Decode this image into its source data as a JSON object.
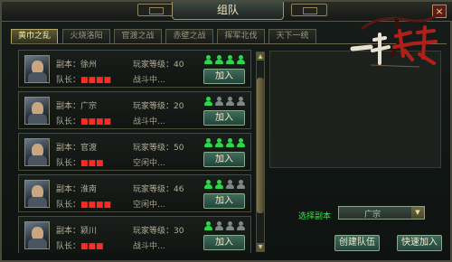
{
  "window": {
    "title": "组队",
    "close_glyph": "×"
  },
  "tabs": [
    "黄巾之乱",
    "火烧洛阳",
    "官渡之战",
    "赤壁之战",
    "挥军北伐",
    "天下一统"
  ],
  "active_tab_index": 0,
  "labels": {
    "dungeon_prefix": "副本：",
    "leader_prefix": "队长：",
    "level_prefix": "玩家等级："
  },
  "teams": [
    {
      "dungeon": "徐州",
      "leader": "■■■■",
      "level": "40",
      "status": "战斗中...",
      "filled": 4,
      "capacity": 4,
      "join": "加入"
    },
    {
      "dungeon": "广宗",
      "leader": "■■■■",
      "level": "20",
      "status": "战斗中...",
      "filled": 1,
      "capacity": 4,
      "join": "加入"
    },
    {
      "dungeon": "官渡",
      "leader": "■■■",
      "level": "50",
      "status": "空闲中...",
      "filled": 4,
      "capacity": 4,
      "join": "加入"
    },
    {
      "dungeon": "淮南",
      "leader": "■■■■",
      "level": "46",
      "status": "空闲中...",
      "filled": 2,
      "capacity": 4,
      "join": "加入"
    },
    {
      "dungeon": "颍川",
      "leader": "■■■",
      "level": "30",
      "status": "战斗中...",
      "filled": 1,
      "capacity": 4,
      "join": "加入"
    }
  ],
  "right": {
    "select_label": "选择副本",
    "select_value": "广宗",
    "create_button": "创建队伍",
    "quick_join_button": "快速加入"
  },
  "colors": {
    "pawn_on": "#2fd64a",
    "pawn_off": "#7e8884",
    "leader_name": "#ff2a22",
    "select_label": "#3ee04e"
  }
}
